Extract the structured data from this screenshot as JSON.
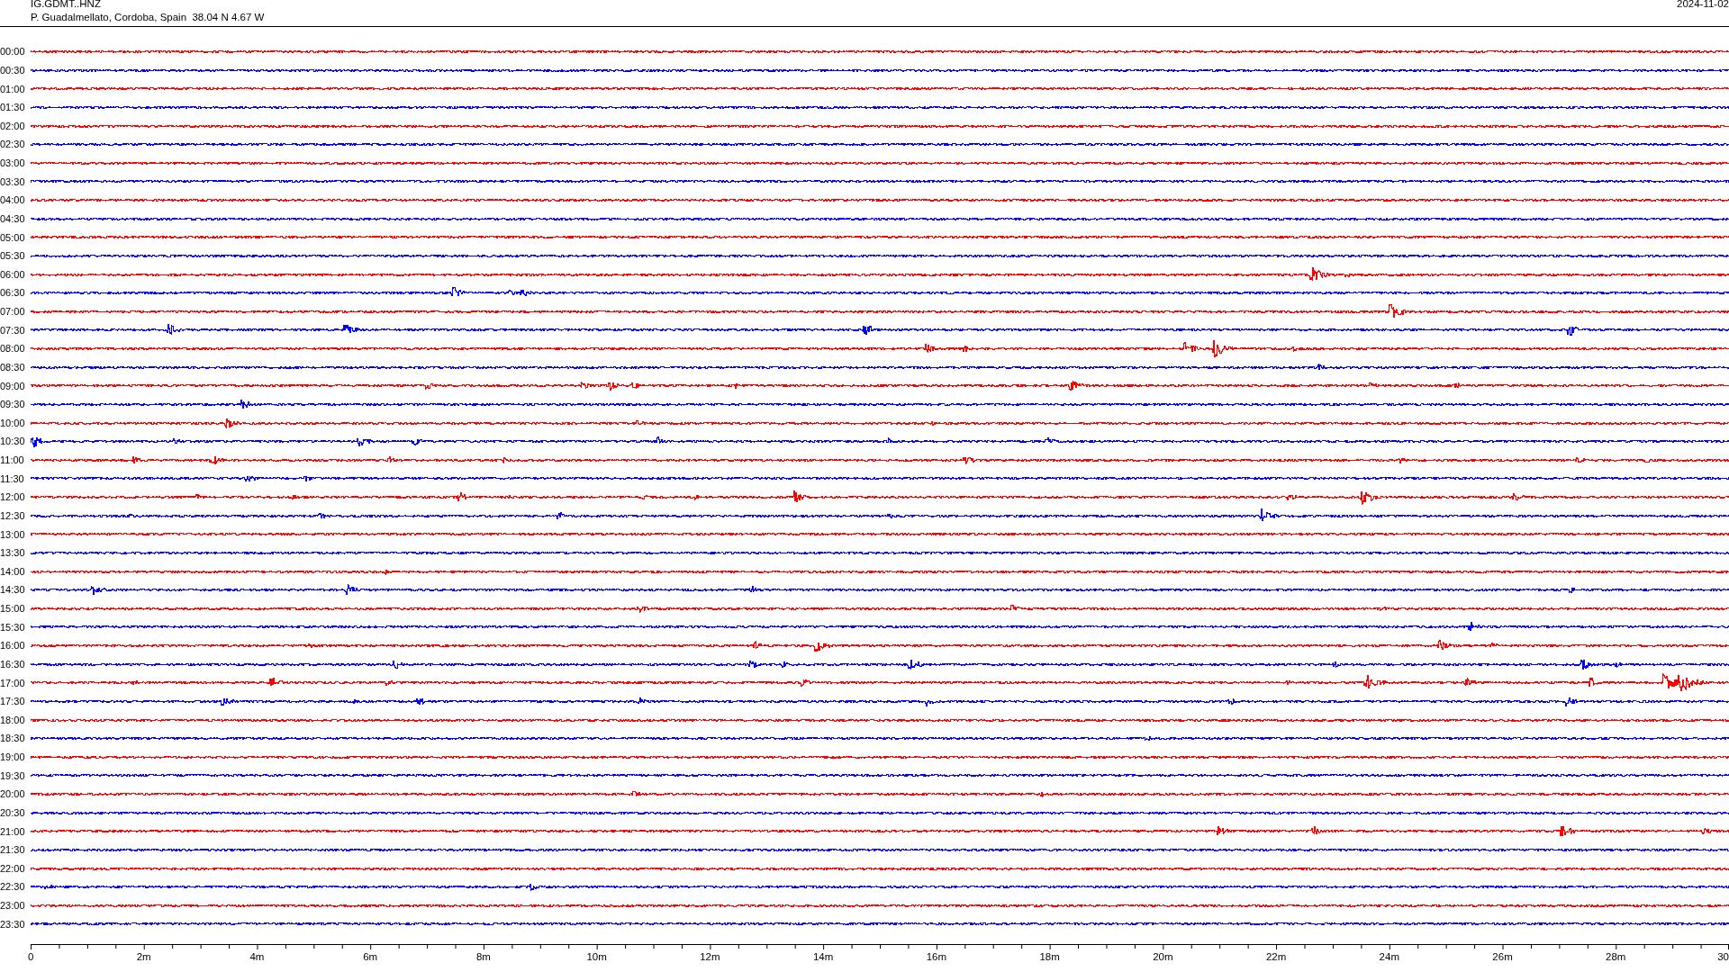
{
  "header": {
    "station": "IG.GDMT..HNZ",
    "location": "P. Guadalmellato, Cordoba, Spain  38.04 N 4.67 W",
    "date": "2024-11-02"
  },
  "rows": [
    {
      "label": "00:00",
      "color": "#ff0000"
    },
    {
      "label": "00:30",
      "color": "#0000ff"
    },
    {
      "label": "01:00",
      "color": "#ff0000"
    },
    {
      "label": "01:30",
      "color": "#0000ff"
    },
    {
      "label": "02:00",
      "color": "#ff0000"
    },
    {
      "label": "02:30",
      "color": "#0000ff"
    },
    {
      "label": "03:00",
      "color": "#ff0000"
    },
    {
      "label": "03:30",
      "color": "#0000ff"
    },
    {
      "label": "04:00",
      "color": "#ff0000"
    },
    {
      "label": "04:30",
      "color": "#0000ff"
    },
    {
      "label": "05:00",
      "color": "#ff0000"
    },
    {
      "label": "05:30",
      "color": "#0000ff"
    },
    {
      "label": "06:00",
      "color": "#ff0000"
    },
    {
      "label": "06:30",
      "color": "#0000ff"
    },
    {
      "label": "07:00",
      "color": "#ff0000"
    },
    {
      "label": "07:30",
      "color": "#0000ff"
    },
    {
      "label": "08:00",
      "color": "#ff0000"
    },
    {
      "label": "08:30",
      "color": "#0000ff"
    },
    {
      "label": "09:00",
      "color": "#ff0000"
    },
    {
      "label": "09:30",
      "color": "#0000ff"
    },
    {
      "label": "10:00",
      "color": "#ff0000"
    },
    {
      "label": "10:30",
      "color": "#0000ff"
    },
    {
      "label": "11:00",
      "color": "#ff0000"
    },
    {
      "label": "11:30",
      "color": "#0000ff"
    },
    {
      "label": "12:00",
      "color": "#ff0000"
    },
    {
      "label": "12:30",
      "color": "#0000ff"
    },
    {
      "label": "13:00",
      "color": "#ff0000"
    },
    {
      "label": "13:30",
      "color": "#0000ff"
    },
    {
      "label": "14:00",
      "color": "#ff0000"
    },
    {
      "label": "14:30",
      "color": "#0000ff"
    },
    {
      "label": "15:00",
      "color": "#ff0000"
    },
    {
      "label": "15:30",
      "color": "#0000ff"
    },
    {
      "label": "16:00",
      "color": "#ff0000"
    },
    {
      "label": "16:30",
      "color": "#0000ff"
    },
    {
      "label": "17:00",
      "color": "#ff0000"
    },
    {
      "label": "17:30",
      "color": "#0000ff"
    },
    {
      "label": "18:00",
      "color": "#ff0000"
    },
    {
      "label": "18:30",
      "color": "#0000ff"
    },
    {
      "label": "19:00",
      "color": "#ff0000"
    },
    {
      "label": "19:30",
      "color": "#0000ff"
    },
    {
      "label": "20:00",
      "color": "#ff0000"
    },
    {
      "label": "20:30",
      "color": "#0000ff"
    },
    {
      "label": "21:00",
      "color": "#ff0000"
    },
    {
      "label": "21:30",
      "color": "#0000ff"
    },
    {
      "label": "22:00",
      "color": "#ff0000"
    },
    {
      "label": "22:30",
      "color": "#0000ff"
    },
    {
      "label": "23:00",
      "color": "#ff0000"
    },
    {
      "label": "23:30",
      "color": "#0000ff"
    }
  ],
  "x_axis": {
    "labels": [
      "0",
      "2m",
      "4m",
      "6m",
      "8m",
      "10m",
      "12m",
      "14m",
      "16m",
      "18m",
      "20m",
      "22m",
      "24m",
      "26m",
      "28m",
      "30"
    ]
  }
}
